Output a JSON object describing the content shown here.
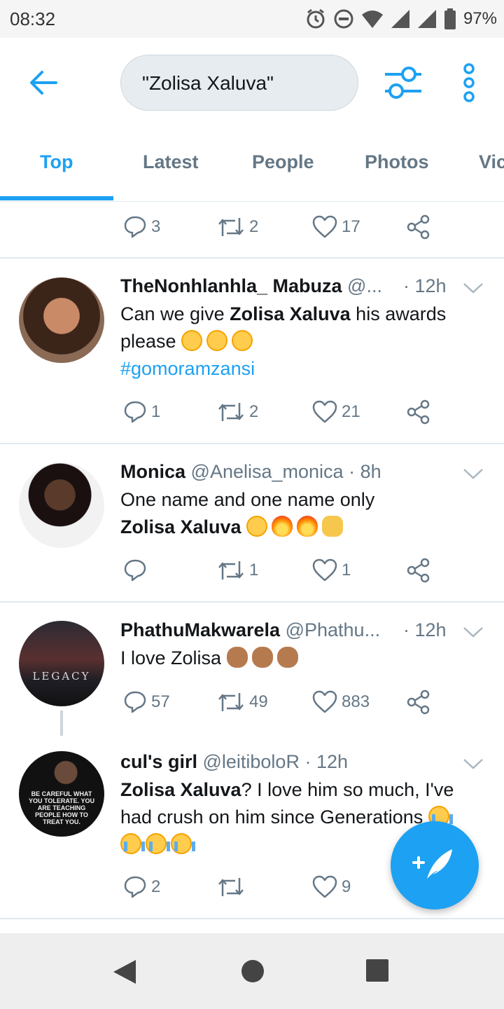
{
  "status_bar": {
    "time": "08:32",
    "battery": "97%"
  },
  "search": {
    "query": "\"Zolisa Xaluva\""
  },
  "tabs": [
    {
      "label": "Top",
      "active": true
    },
    {
      "label": "Latest",
      "active": false
    },
    {
      "label": "People",
      "active": false
    },
    {
      "label": "Photos",
      "active": false
    },
    {
      "label": "Vic",
      "active": false
    }
  ],
  "colors": {
    "accent": "#1da1f2",
    "secondary_text": "#657786",
    "divider": "#e1e8ed"
  },
  "partial_tweet": {
    "replies": "3",
    "retweets": "2",
    "likes": "17"
  },
  "tweets": [
    {
      "name": "TheNonhlanhla_ Mabuza",
      "handle": "@...",
      "time": "· 12h",
      "text_pre": "Can we give ",
      "text_bold": "Zolisa Xaluva",
      "text_post": " his awards please",
      "emojis": [
        "rolling-eyes",
        "rolling-eyes",
        "rolling-eyes"
      ],
      "hashtag": "#gomoramzansi",
      "replies": "1",
      "retweets": "2",
      "likes": "21"
    },
    {
      "name": "Monica",
      "handle": "@Anelisa_monica",
      "time": "· 8h",
      "text_line1": "One name and one name only",
      "text_bold": "Zolisa Xaluva",
      "emojis": [
        "weary-face",
        "fire",
        "fire",
        "raised-hands"
      ],
      "replies": "",
      "retweets": "1",
      "likes": "1"
    },
    {
      "name": "PhathuMakwarela",
      "handle": "@Phathu...",
      "time": "· 12h",
      "text": "I love Zolisa",
      "emojis": [
        "ok-hand",
        "ok-hand",
        "ok-hand"
      ],
      "avatar_text": "LEGACY",
      "replies": "57",
      "retweets": "49",
      "likes": "883"
    },
    {
      "name": "cul's girl",
      "handle": "@leitiboloR",
      "time": "· 12h",
      "text_bold": "Zolisa Xaluva",
      "text_post": "? I love him so much, I've had crush on him since Generations",
      "emojis": [
        "loudly-crying",
        "loudly-crying",
        "loudly-crying",
        "loudly-crying"
      ],
      "avatar_text": "BE CAREFUL WHAT YOU TOLERATE. YOU ARE TEACHING PEOPLE HOW TO TREAT YOU.",
      "replies": "2",
      "retweets": "",
      "likes": "9"
    }
  ],
  "icons": [
    "back-arrow-icon",
    "filter-icon",
    "more-vertical-icon",
    "reply-icon",
    "retweet-icon",
    "like-icon",
    "share-icon",
    "compose-icon",
    "nav-back-icon",
    "nav-home-icon",
    "nav-recents-icon"
  ]
}
